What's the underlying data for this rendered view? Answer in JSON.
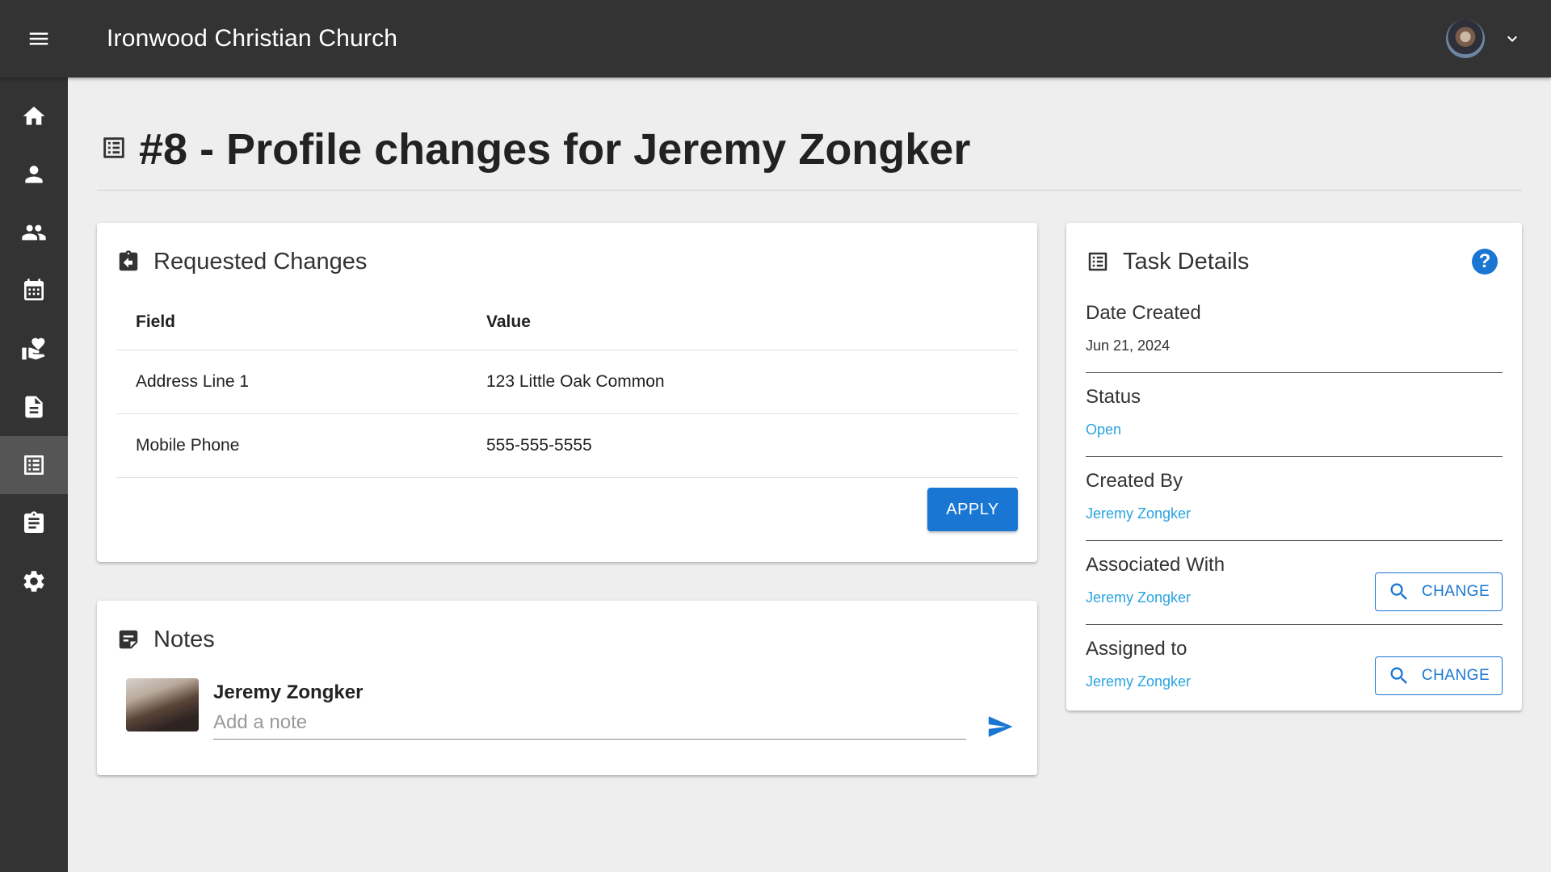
{
  "app": {
    "title": "Ironwood Christian Church"
  },
  "header": {
    "user_menu_icon": "chevron-down-icon"
  },
  "sidebar": {
    "items": [
      {
        "name": "home",
        "icon": "home-icon"
      },
      {
        "name": "person",
        "icon": "person-icon"
      },
      {
        "name": "groups",
        "icon": "groups-icon"
      },
      {
        "name": "calendar",
        "icon": "calendar-icon"
      },
      {
        "name": "donations",
        "icon": "hand-heart-icon"
      },
      {
        "name": "forms",
        "icon": "document-icon"
      },
      {
        "name": "tasks",
        "icon": "list-alt-icon",
        "active": true
      },
      {
        "name": "plans",
        "icon": "clipboard-icon"
      },
      {
        "name": "settings",
        "icon": "gear-icon"
      }
    ]
  },
  "page": {
    "title": "#8 - Profile changes for Jeremy Zongker"
  },
  "requested_changes": {
    "title": "Requested Changes",
    "columns": [
      "Field",
      "Value"
    ],
    "rows": [
      {
        "field": "Address Line 1",
        "value": "123 Little Oak Common"
      },
      {
        "field": "Mobile Phone",
        "value": "555-555-5555"
      }
    ],
    "apply_label": "APPLY"
  },
  "notes": {
    "title": "Notes",
    "author": "Jeremy Zongker",
    "placeholder": "Add a note"
  },
  "task_details": {
    "title": "Task Details",
    "help_label": "?",
    "date_created": {
      "label": "Date Created",
      "value": "Jun 21, 2024"
    },
    "status": {
      "label": "Status",
      "value": "Open"
    },
    "created_by": {
      "label": "Created By",
      "value": "Jeremy Zongker"
    },
    "associated_with": {
      "label": "Associated With",
      "value": "Jeremy Zongker",
      "button": "CHANGE"
    },
    "assigned_to": {
      "label": "Assigned to",
      "value": "Jeremy Zongker",
      "button": "CHANGE"
    }
  },
  "colors": {
    "primary": "#1976d2",
    "link": "#29a3e0",
    "topbar": "#333333",
    "background": "#eeeeee"
  }
}
